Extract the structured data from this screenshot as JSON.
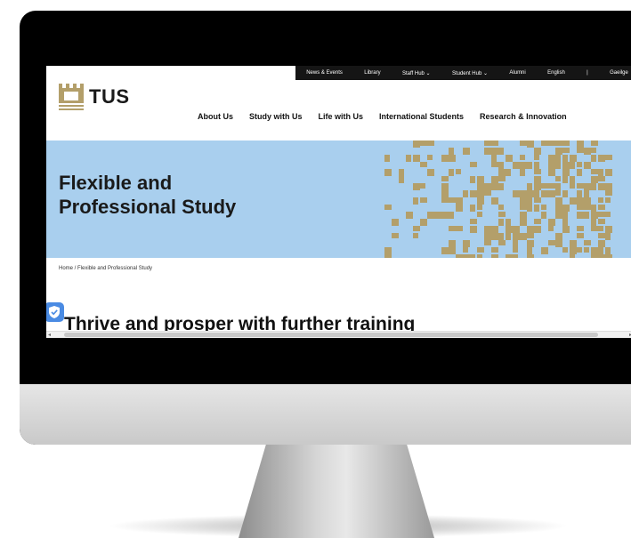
{
  "topbar": {
    "links": [
      "News & Events",
      "Library",
      "Staff Hub ⌄",
      "Student Hub ⌄",
      "Alumni",
      "English",
      "|",
      "Gaeilge"
    ]
  },
  "logo": {
    "text": "TUS",
    "mark_color": "#b39f6a"
  },
  "nav": {
    "items": [
      "About Us",
      "Study with Us",
      "Life with Us",
      "International Students",
      "Research & Innovation"
    ]
  },
  "hero": {
    "title_line1": "Flexible and",
    "title_line2": "Professional Study",
    "bg_color": "#a9cfee",
    "accent_color": "#b39f6a"
  },
  "breadcrumb": {
    "text": "Home / Flexible and Professional Study"
  },
  "content": {
    "subheading": "Thrive and prosper with further training"
  },
  "icons": {
    "shield": "shield-check-icon",
    "scroll_left": "◂",
    "scroll_right": "▸"
  }
}
